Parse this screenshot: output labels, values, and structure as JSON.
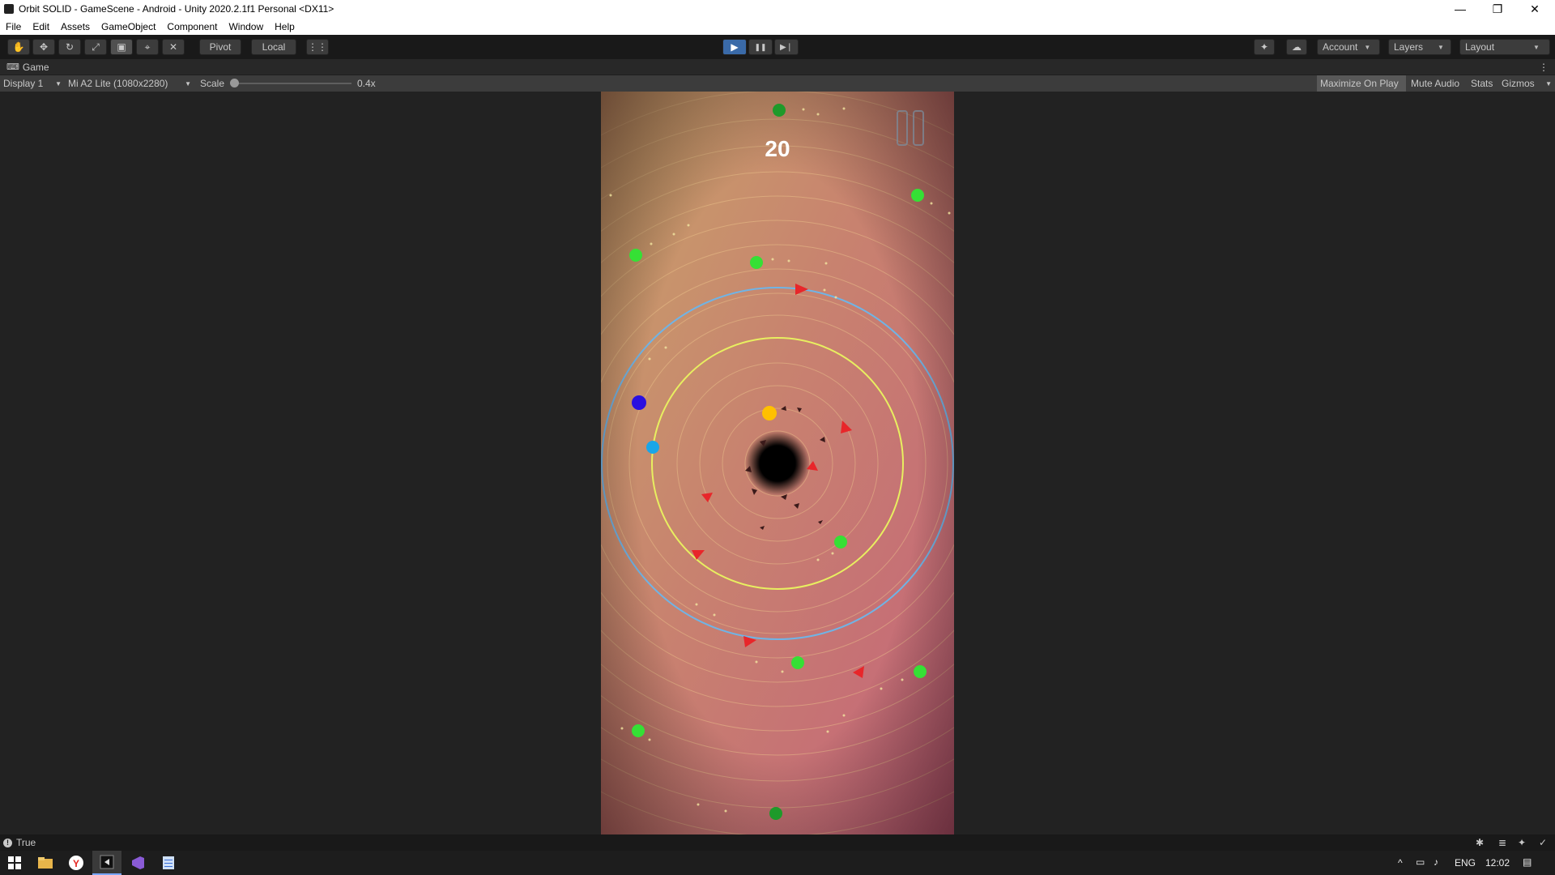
{
  "window": {
    "title": "Orbit SOLID - GameScene - Android - Unity 2020.2.1f1 Personal <DX11>",
    "minimize": "—",
    "restore": "❐",
    "close": "✕"
  },
  "menu": [
    "File",
    "Edit",
    "Assets",
    "GameObject",
    "Component",
    "Window",
    "Help"
  ],
  "toolbar": {
    "tools": [
      {
        "name": "hand-tool",
        "glyph": "✋"
      },
      {
        "name": "move-tool",
        "glyph": "✥"
      },
      {
        "name": "rotate-tool",
        "glyph": "↻"
      },
      {
        "name": "scale-tool",
        "glyph": "⤢"
      },
      {
        "name": "rect-tool",
        "glyph": "▣"
      },
      {
        "name": "transform-tool",
        "glyph": "⌖"
      },
      {
        "name": "custom-tool",
        "glyph": "✕"
      }
    ],
    "pivot_label": "Pivot",
    "local_label": "Local",
    "play_glyph": "▶",
    "pause_glyph": "❚❚",
    "step_glyph": "▶❘",
    "account_label": "Account",
    "layers_label": "Layers",
    "layout_label": "Layout"
  },
  "game_view": {
    "tab_label": "Game",
    "display_label": "Display 1",
    "resolution_label": "Mi A2 Lite (1080x2280)",
    "scale_label": "Scale",
    "scale_value": "0.4x",
    "maximize_label": "Maximize On Play",
    "mute_label": "Mute Audio",
    "stats_label": "Stats",
    "gizmos_label": "Gizmos",
    "score": "20"
  },
  "status": {
    "message": "True"
  },
  "taskbar": {
    "lang": "ENG",
    "time": "12:02"
  }
}
